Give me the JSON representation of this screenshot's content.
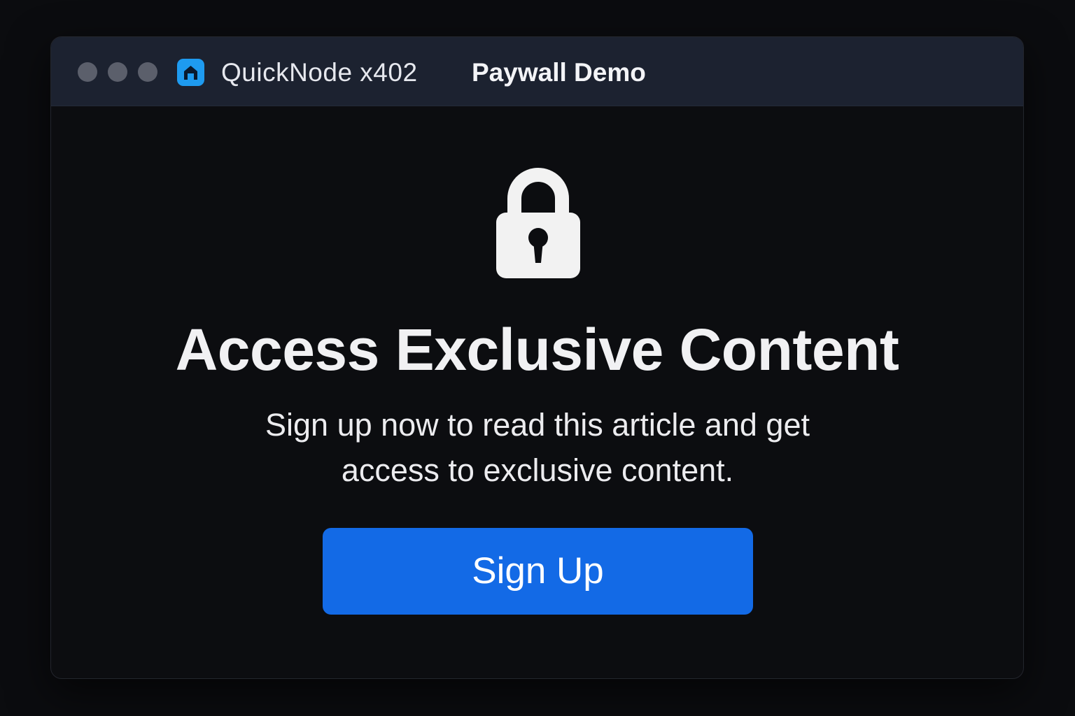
{
  "window": {
    "app_name": "QuickNode x402",
    "tab_title": "Paywall Demo",
    "app_icon": "home-icon",
    "traffic_lights": [
      "close",
      "minimize",
      "maximize"
    ]
  },
  "paywall": {
    "icon": "lock-icon",
    "headline": "Access Exclusive Content",
    "subtext": "Sign up now to read this article and get access to exclusive content.",
    "cta_label": "Sign Up"
  },
  "colors": {
    "background": "#0b0c0f",
    "titlebar": "#1c2230",
    "accent": "#136ae6",
    "app_icon": "#1e9bf0",
    "text": "#f1f1f3"
  }
}
